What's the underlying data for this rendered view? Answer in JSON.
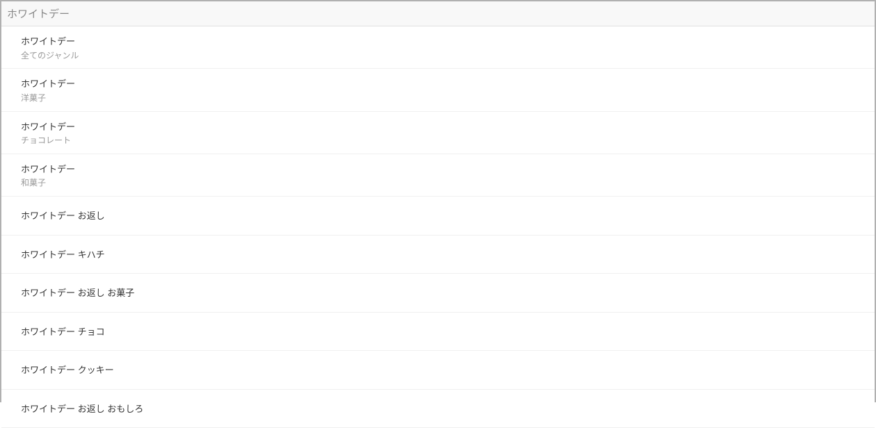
{
  "search": {
    "value": "ホワイトデー"
  },
  "suggestions": [
    {
      "title": "ホワイトデー",
      "category": "全てのジャンル"
    },
    {
      "title": "ホワイトデー",
      "category": "洋菓子"
    },
    {
      "title": "ホワイトデー",
      "category": "チョコレート"
    },
    {
      "title": "ホワイトデー",
      "category": "和菓子"
    },
    {
      "title": "ホワイトデー お返し"
    },
    {
      "title": "ホワイトデー キハチ"
    },
    {
      "title": "ホワイトデー お返し お菓子"
    },
    {
      "title": "ホワイトデー チョコ"
    },
    {
      "title": "ホワイトデー クッキー"
    },
    {
      "title": "ホワイトデー お返し おもしろ"
    }
  ]
}
